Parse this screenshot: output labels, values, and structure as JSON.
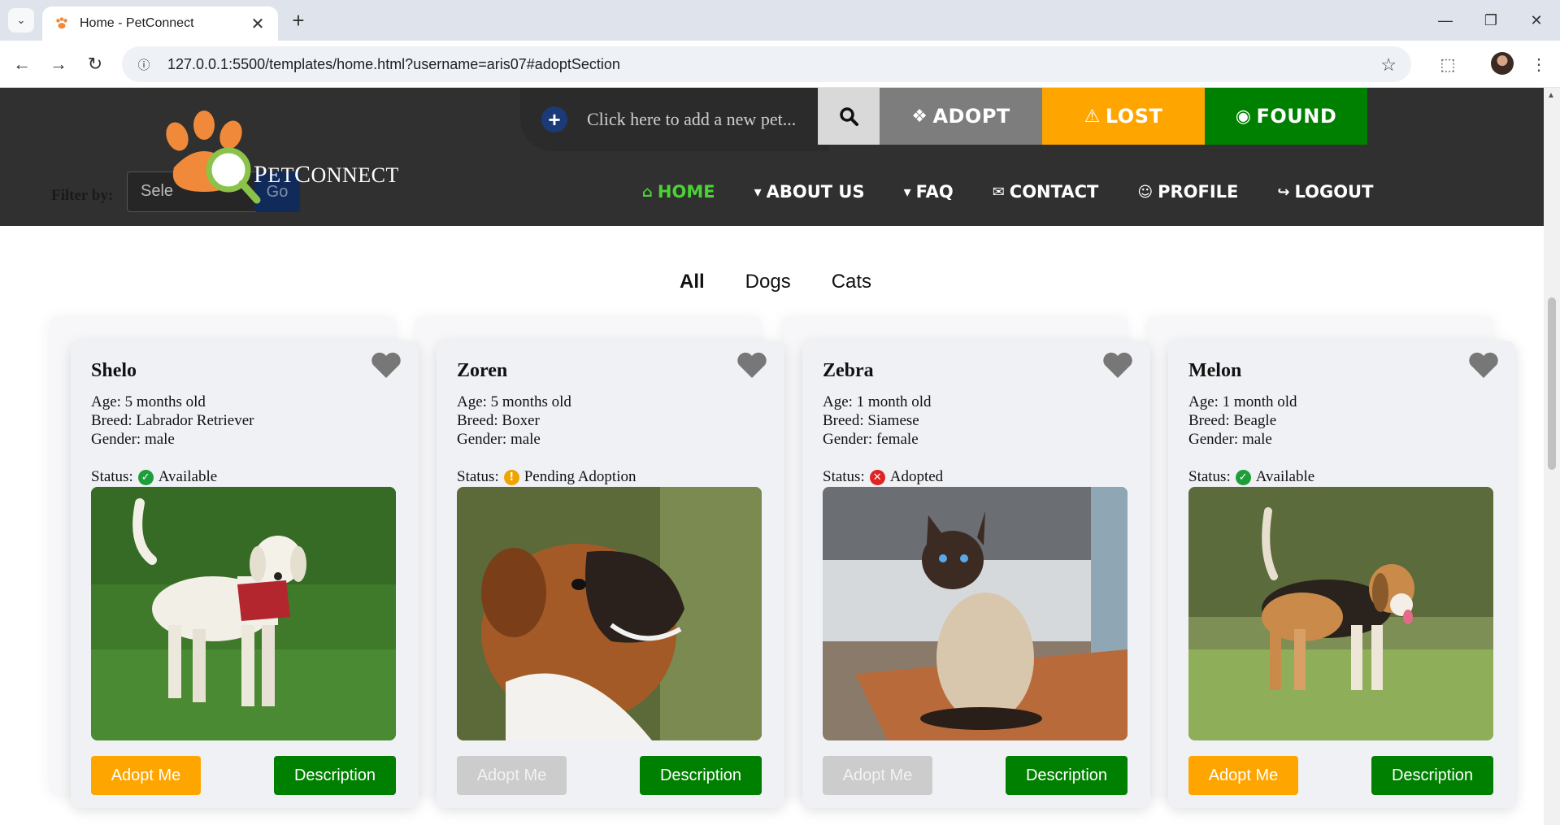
{
  "browser": {
    "tab_title": "Home - PetConnect",
    "url": "127.0.0.1:5500/templates/home.html?username=aris07#adoptSection"
  },
  "header": {
    "add_pet_text": "Click here to add a new pet...",
    "buttons": {
      "adopt": "ADOPT",
      "lost": "LOST",
      "found": "FOUND"
    },
    "filter_label": "Filter by:",
    "filter_select": "Sele",
    "filter_go": "Go",
    "logo_text_a": "P",
    "logo_text_b": "ET",
    "logo_text_c": "C",
    "logo_text_d": "ONNECT",
    "nav": [
      {
        "label": "HOME",
        "icon": "home-icon",
        "active": true
      },
      {
        "label": "ABOUT US",
        "icon": "caret-down-icon"
      },
      {
        "label": "FAQ",
        "icon": "caret-down-icon"
      },
      {
        "label": "CONTACT",
        "icon": "envelope-icon"
      },
      {
        "label": "PROFILE",
        "icon": "user-icon"
      },
      {
        "label": "LOGOUT",
        "icon": "sign-out-icon"
      }
    ]
  },
  "tabs": [
    "All",
    "Dogs",
    "Cats"
  ],
  "colors": {
    "available": "#1e9e3a",
    "pending": "#f0a400",
    "adopted": "#e02424",
    "adopt_btn": "#ffa500",
    "desc_btn": "#008000"
  },
  "pets": [
    {
      "name": "Shelo",
      "age": "Age: 5 months old",
      "breed": "Breed: Labrador Retriever",
      "gender": "Gender: male",
      "status_label": "Status:",
      "status": "Available",
      "status_icon": "check-circle-icon",
      "adopt": "Adopt Me",
      "adopt_enabled": true,
      "desc": "Description"
    },
    {
      "name": "Zoren",
      "age": "Age: 5 months old",
      "breed": "Breed: Boxer",
      "gender": "Gender: male",
      "status_label": "Status:",
      "status": "Pending Adoption",
      "status_icon": "exclamation-circle-icon",
      "adopt": "Adopt Me",
      "adopt_enabled": false,
      "desc": "Description"
    },
    {
      "name": "Zebra",
      "age": "Age: 1 month old",
      "breed": "Breed: Siamese",
      "gender": "Gender: female",
      "status_label": "Status:",
      "status": "Adopted",
      "status_icon": "x-circle-icon",
      "adopt": "Adopt Me",
      "adopt_enabled": false,
      "desc": "Description"
    },
    {
      "name": "Melon",
      "age": "Age: 1 month old",
      "breed": "Breed: Beagle",
      "gender": "Gender: male",
      "status_label": "Status:",
      "status": "Available",
      "status_icon": "check-circle-icon",
      "adopt": "Adopt Me",
      "adopt_enabled": true,
      "desc": "Description"
    }
  ]
}
